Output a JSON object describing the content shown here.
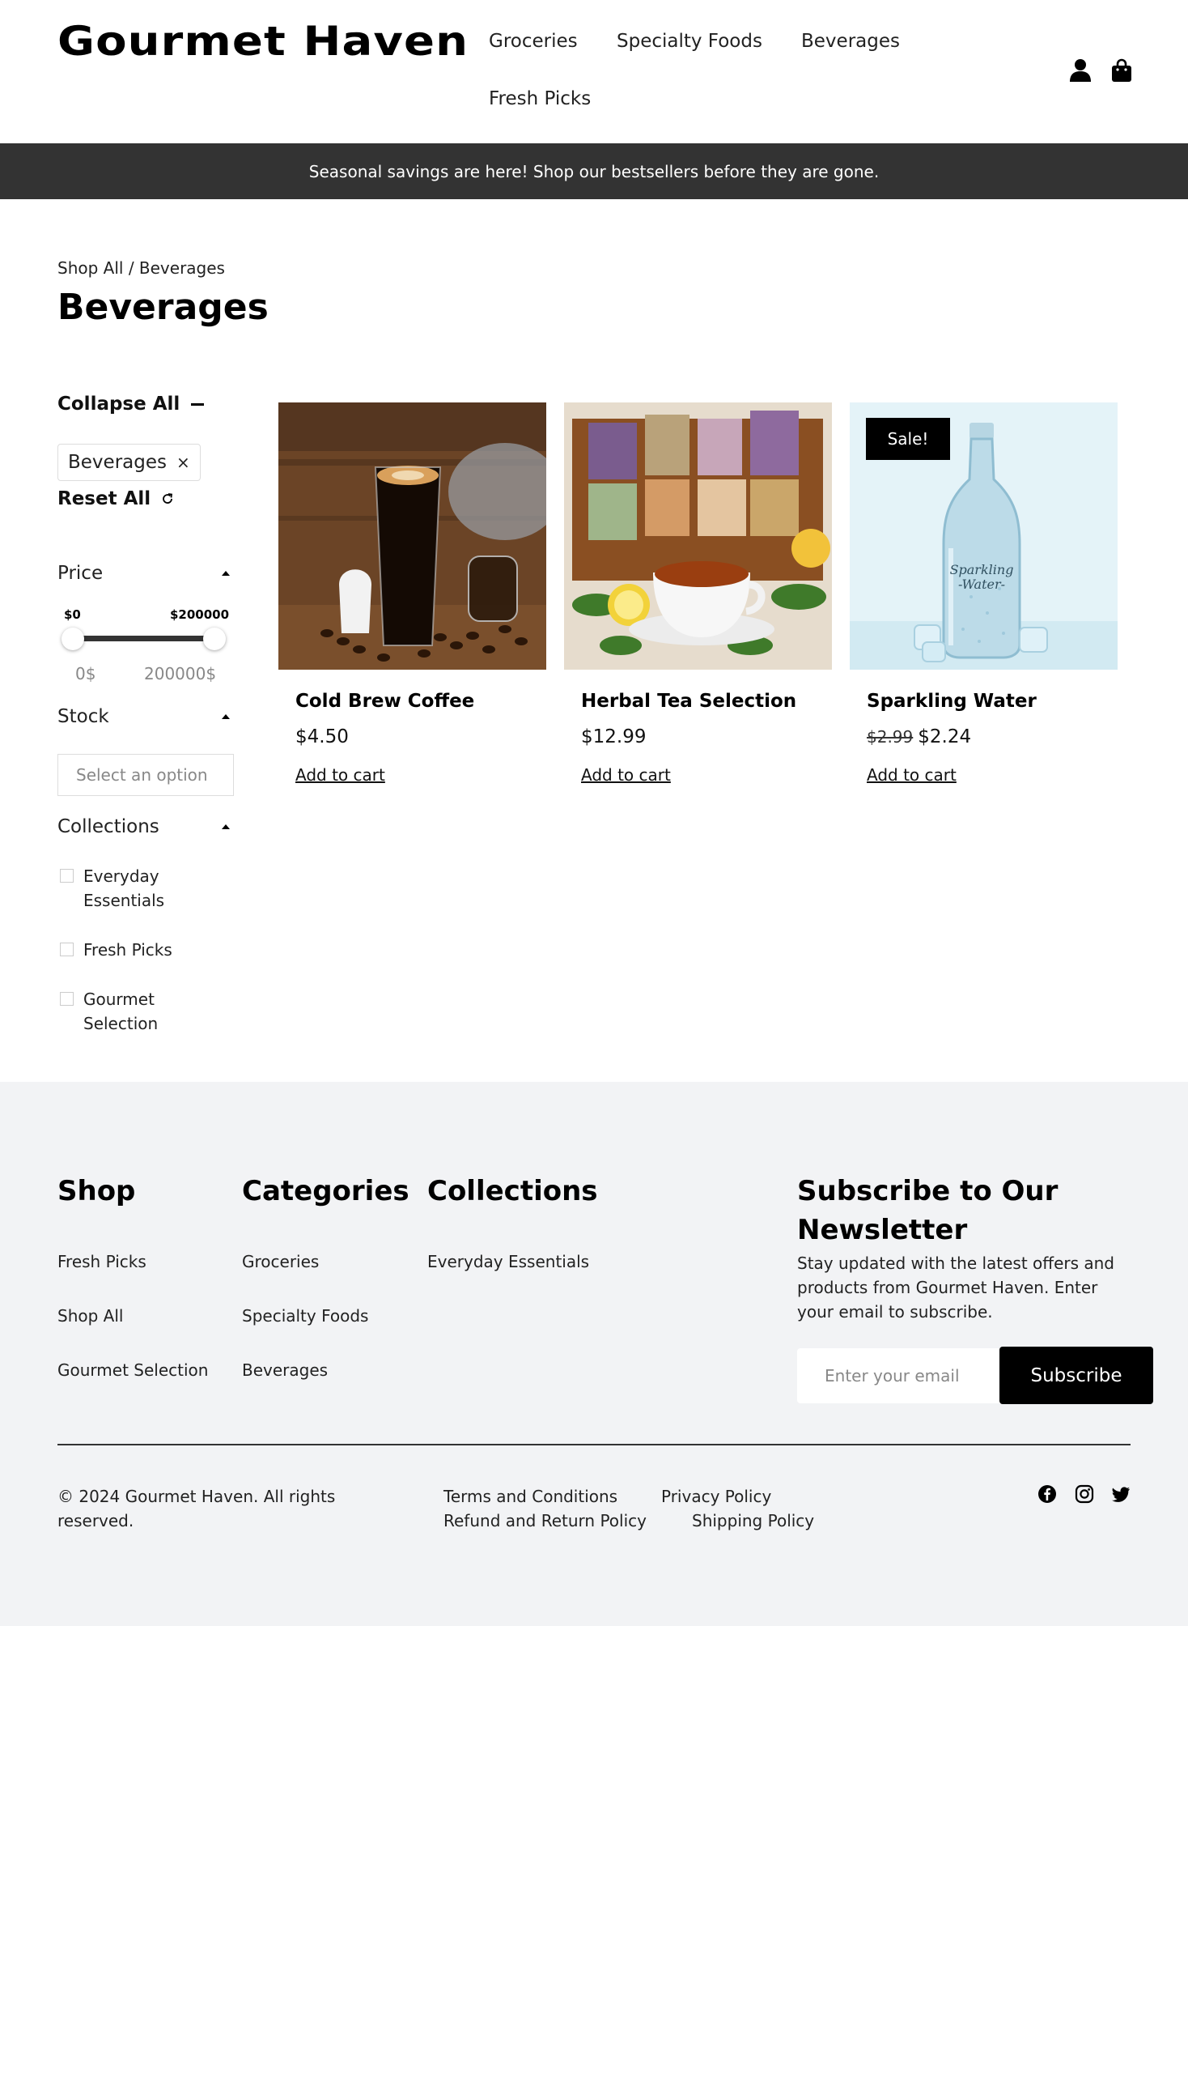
{
  "brand": {
    "logo": "Gourmet Haven"
  },
  "nav": {
    "items": [
      "Groceries",
      "Specialty Foods",
      "Beverages",
      "Fresh Picks"
    ]
  },
  "header_icons": [
    "account-icon",
    "shopping-bag-icon"
  ],
  "announcement": "Seasonal savings are here! Shop our bestsellers before they are gone.",
  "breadcrumb": "Shop All / Beverages",
  "page_title": "Beverages",
  "filters": {
    "collapse_all": "Collapse All",
    "active_chip": "Beverages",
    "chip_remove": "×",
    "reset_all": "Reset All",
    "price": {
      "label": "Price",
      "min_label": "$0",
      "max_label": "$200000",
      "min_input": "0$",
      "max_input": "200000$"
    },
    "stock": {
      "label": "Stock",
      "placeholder": "Select an option"
    },
    "collections": {
      "label": "Collections",
      "options": [
        {
          "line1": "Everyday",
          "line2": "Essentials"
        },
        {
          "line1": "Fresh Picks",
          "line2": ""
        },
        {
          "line1": "Gourmet",
          "line2": "Selection"
        }
      ]
    }
  },
  "products": [
    {
      "name": "Cold Brew Coffee",
      "price": "$4.50",
      "old_price": "",
      "cta": "Add to cart",
      "image": "cold-brew-coffee-image"
    },
    {
      "name": "Herbal Tea Selection",
      "price": "$12.99",
      "old_price": "",
      "cta": "Add to cart",
      "image": "herbal-tea-image"
    },
    {
      "name": "Sparkling Water",
      "price": "$2.24",
      "old_price": "$2.99",
      "cta": "Add to cart",
      "badge": "Sale!",
      "image": "sparkling-water-image",
      "image_text_1": "Sparkling",
      "image_text_2": "-Water-"
    }
  ],
  "footer": {
    "shop": {
      "title": "Shop",
      "links": [
        "Fresh Picks",
        "Shop All",
        "Gourmet Selection"
      ]
    },
    "categories": {
      "title": "Categories",
      "links": [
        "Groceries",
        "Specialty Foods",
        "Beverages"
      ]
    },
    "collections": {
      "title": "Collections",
      "links": [
        "Everyday Essentials"
      ]
    },
    "newsletter": {
      "title_line1": "Subscribe to Our",
      "title_line2": "Newsletter",
      "description": "Stay updated with the latest offers and products from Gourmet Haven. Enter your email to subscribe.",
      "placeholder": "Enter your email",
      "button": "Subscribe"
    },
    "copyright_line1": "© 2024 Gourmet Haven. All rights",
    "copyright_line2": "reserved.",
    "policies": [
      "Terms and Conditions",
      "Privacy Policy",
      "Refund and Return Policy",
      "Shipping Policy"
    ],
    "social_icons": [
      "facebook-icon",
      "instagram-icon",
      "twitter-icon"
    ]
  },
  "colors": {
    "announcement_bg": "#333333",
    "footer_bg": "#f2f3f5",
    "accent": "#000000"
  }
}
